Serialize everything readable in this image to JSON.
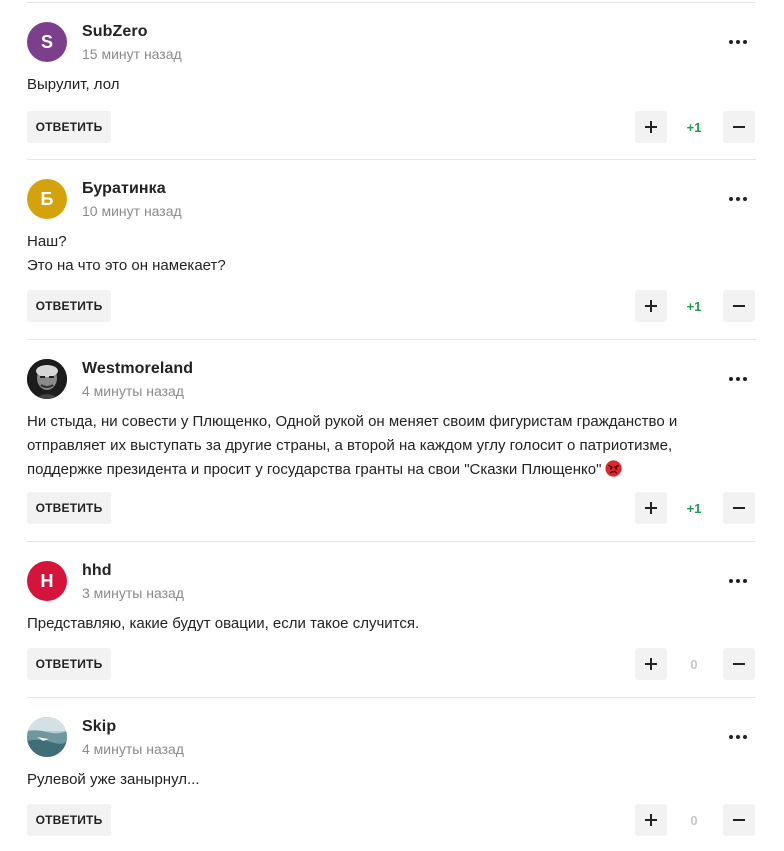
{
  "ui": {
    "reply_label": "ОТВЕТИТЬ"
  },
  "colors": {
    "positive_rating": "#1a9e4b",
    "neutral_rating": "#c8c8c8",
    "button_bg": "#f2f2f2"
  },
  "comments": [
    {
      "author": "SubZero",
      "time": "15 минут назад",
      "avatar_letter": "S",
      "avatar_color": "#7b3f8c",
      "lines": [
        "Вырулит, лол"
      ],
      "rating": "+1"
    },
    {
      "author": "Буратинка",
      "time": "10 минут назад",
      "avatar_letter": "Б",
      "avatar_color": "#d4a20c",
      "lines": [
        "Наш?",
        "Это на что это он намекает?"
      ],
      "rating": "+1"
    },
    {
      "author": "Westmoreland",
      "time": "4 минуты назад",
      "avatar_letter": "",
      "avatar_color": "#1a1a1a",
      "avatar_icon": "portrait-photo",
      "lines": [
        "Ни стыда, ни совести у Плющенко, Одной рукой он меняет своим фигуристам гражданство и",
        "отправляет их выступать за другие страны, а второй на каждом углу голосит о патриотизме,",
        "поддержке президента и просит у государства гранты на свои \"Сказки Плющенко\""
      ],
      "trailing_icon": "angry-face-emoji",
      "rating": "+1"
    },
    {
      "author": "hhd",
      "time": "3 минуты назад",
      "avatar_letter": "H",
      "avatar_color": "#d4143a",
      "lines": [
        "Представляю, какие будут овации, если такое случится."
      ],
      "rating": "0"
    },
    {
      "author": "Skip",
      "time": "4 минуты назад",
      "avatar_letter": "",
      "avatar_color": "#5f8a93",
      "avatar_icon": "sea-photo",
      "lines": [
        "Рулевой уже занырнул..."
      ],
      "rating": "0"
    }
  ]
}
